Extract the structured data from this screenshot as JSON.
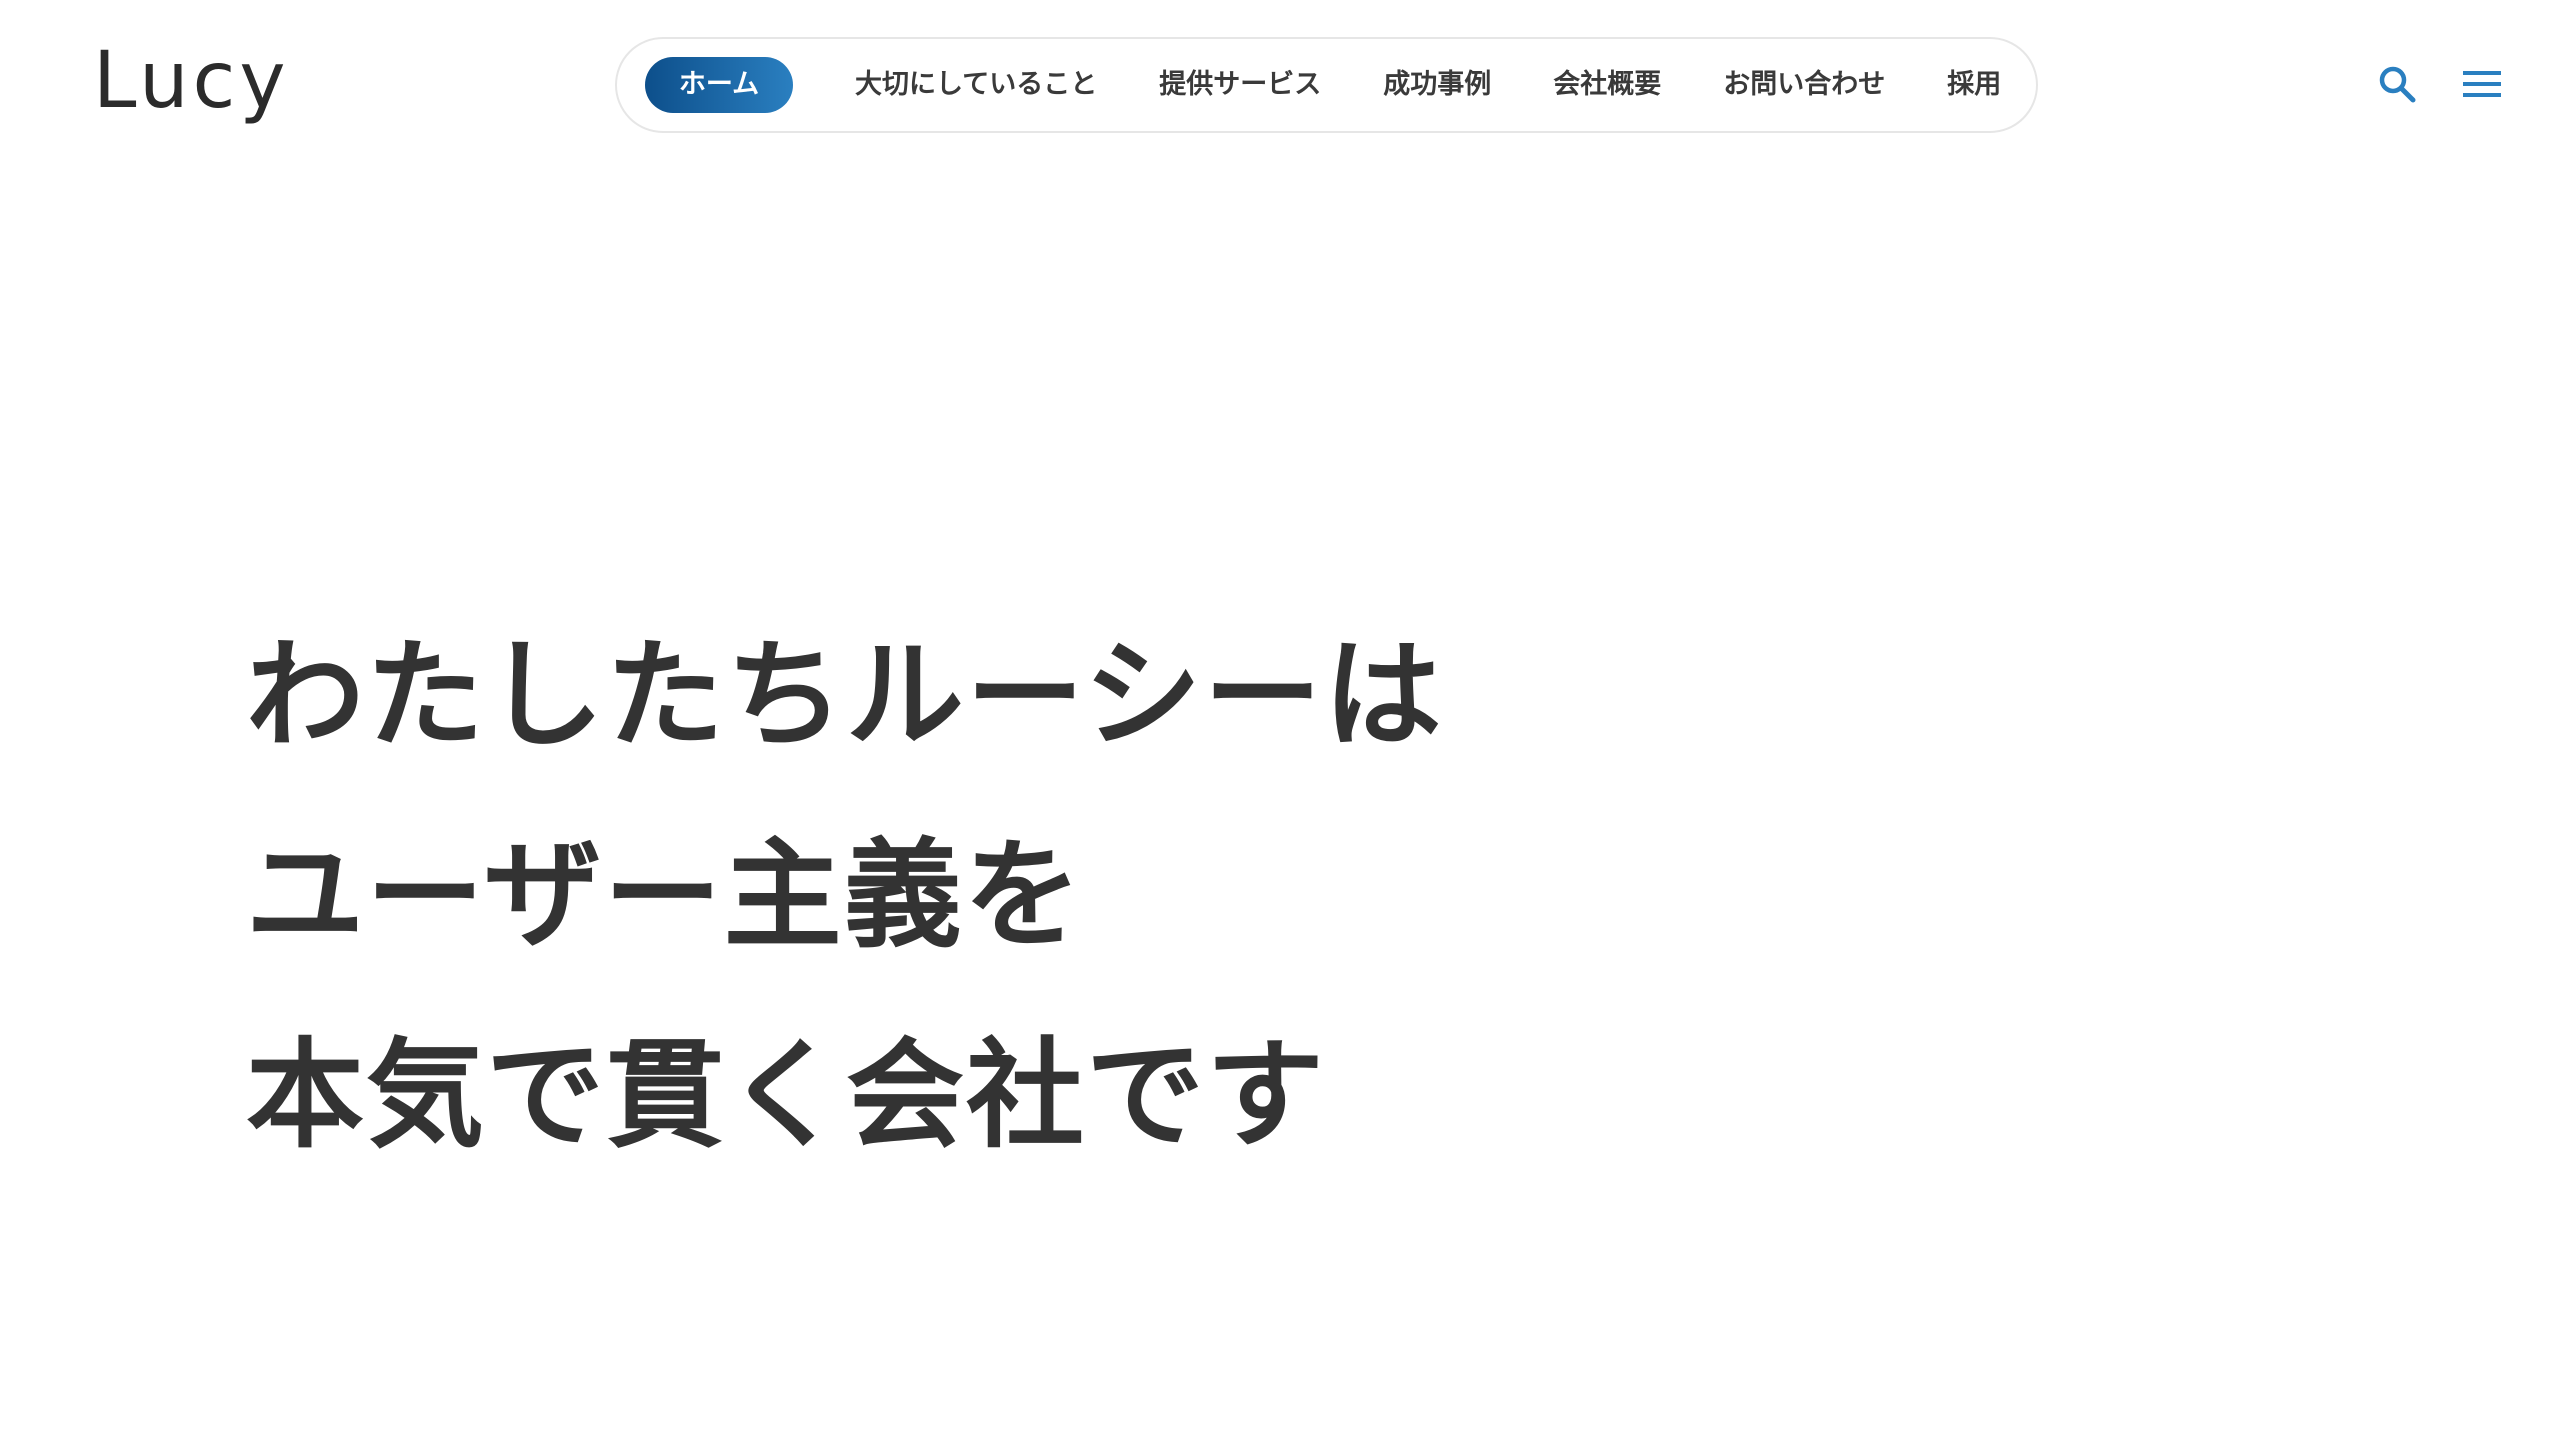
{
  "header": {
    "logo": "Lucy"
  },
  "nav": {
    "items": [
      {
        "label": "ホーム",
        "active": true
      },
      {
        "label": "大切にしていること",
        "active": false
      },
      {
        "label": "提供サービス",
        "active": false
      },
      {
        "label": "成功事例",
        "active": false
      },
      {
        "label": "会社概要",
        "active": false
      },
      {
        "label": "お問い合わせ",
        "active": false
      },
      {
        "label": "採用",
        "active": false
      }
    ]
  },
  "icons": {
    "search": "search-icon",
    "menu": "hamburger-menu-icon"
  },
  "hero": {
    "lines": [
      "わたしたちルーシーは",
      "ユーザー主義を",
      "本気で貫く会社です"
    ]
  },
  "colors": {
    "accent": "#1f6fb2",
    "active_gradient_start": "#0d4f8b",
    "active_gradient_end": "#2a7fc0",
    "text": "#333333",
    "icon": "#2a7fc0"
  }
}
